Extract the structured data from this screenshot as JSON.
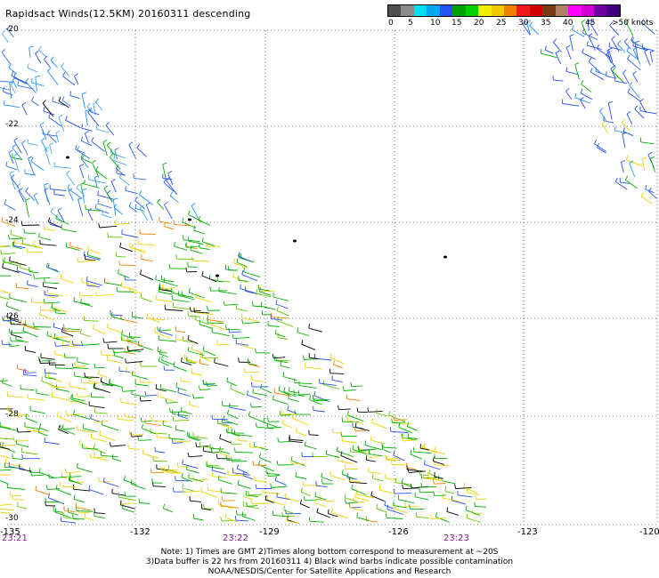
{
  "title": "Rapidsact Winds(12.5KM) 20160311 descending",
  "colorbar": {
    "colors": [
      "#505050",
      "#8c8c8c",
      "#00e0f0",
      "#00a8f0",
      "#2850f0",
      "#00a000",
      "#00d000",
      "#f0f000",
      "#f0c800",
      "#f08000",
      "#f01818",
      "#d00000",
      "#7a3c18",
      "#b08060",
      "#ff00ff",
      "#d000d0",
      "#7000a0",
      "#400080"
    ],
    "labels": [
      "0",
      "5",
      "10",
      "15",
      "20",
      "25",
      "30",
      "35",
      "40",
      "45",
      ">50 knots"
    ]
  },
  "y_ticks": [
    "-20",
    "-22",
    "-24",
    "-26",
    "-28",
    "-30"
  ],
  "x_ticks": [
    "-135",
    "-132",
    "-129",
    "-126",
    "-123",
    "-120"
  ],
  "time_ticks": [
    "23:21",
    "23:22",
    "23:23"
  ],
  "note": [
    "Note: 1) Times are GMT 2)Times along bottom correspond to measurement at ~20S",
    "3)Data buffer is 22 hrs from 20160311 4) Black wind barbs indicate possible contamination",
    "NOAA/NESDIS/Center for Satellite Applications and Research"
  ]
}
